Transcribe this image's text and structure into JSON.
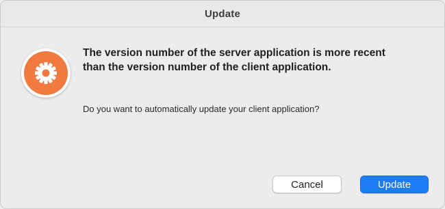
{
  "dialog": {
    "title": "Update",
    "icon": "gear-icon",
    "headline_line1": "The version number of the server application is more recent",
    "headline_line2": "than the version number of the client application.",
    "message": "Do you want to automatically update your client application?",
    "cancel_label": "Cancel",
    "update_label": "Update"
  },
  "colors": {
    "icon_orange": "#f07a3f",
    "primary_button": "#1d7cf2",
    "background": "#ececec"
  }
}
